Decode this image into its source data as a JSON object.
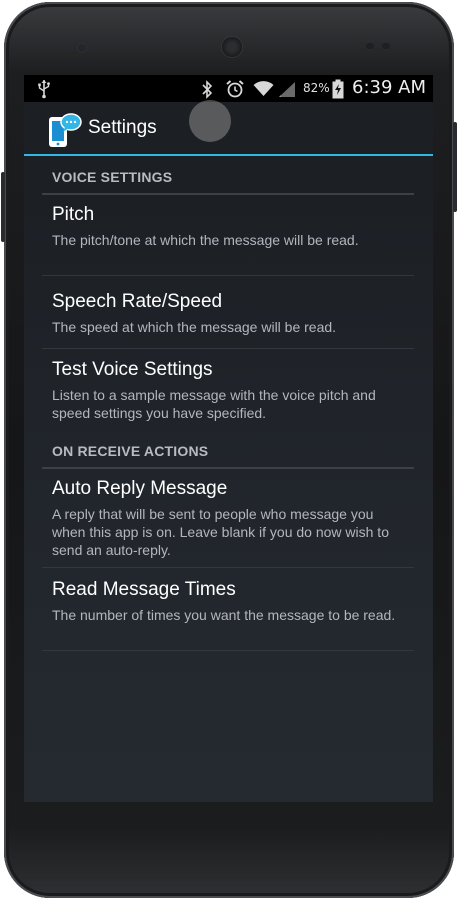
{
  "status_bar": {
    "icons": [
      "usb-icon",
      "bluetooth-icon",
      "alarm-icon",
      "wifi-icon",
      "signal-icon",
      "battery-charging-icon"
    ],
    "battery_percent": "82%",
    "time": "6:39 AM"
  },
  "action_bar": {
    "title": "Settings",
    "accent_color": "#33b5e5"
  },
  "sections": [
    {
      "header": "VOICE SETTINGS",
      "items": [
        {
          "title": "Pitch",
          "summary": "The pitch/tone at which the message will be read."
        },
        {
          "title": "Speech Rate/Speed",
          "summary": "The speed at which the message will be read."
        },
        {
          "title": "Test Voice Settings",
          "summary": "Listen to a sample message with the voice pitch and speed settings you have specified."
        }
      ]
    },
    {
      "header": "ON RECEIVE ACTIONS",
      "items": [
        {
          "title": "Auto Reply Message",
          "summary": "A reply that will be sent to people who message you when this app is on. Leave blank if you do now wish to send an auto-reply."
        },
        {
          "title": "Read Message Times",
          "summary": "The number of times you want the message to be read."
        }
      ]
    }
  ]
}
